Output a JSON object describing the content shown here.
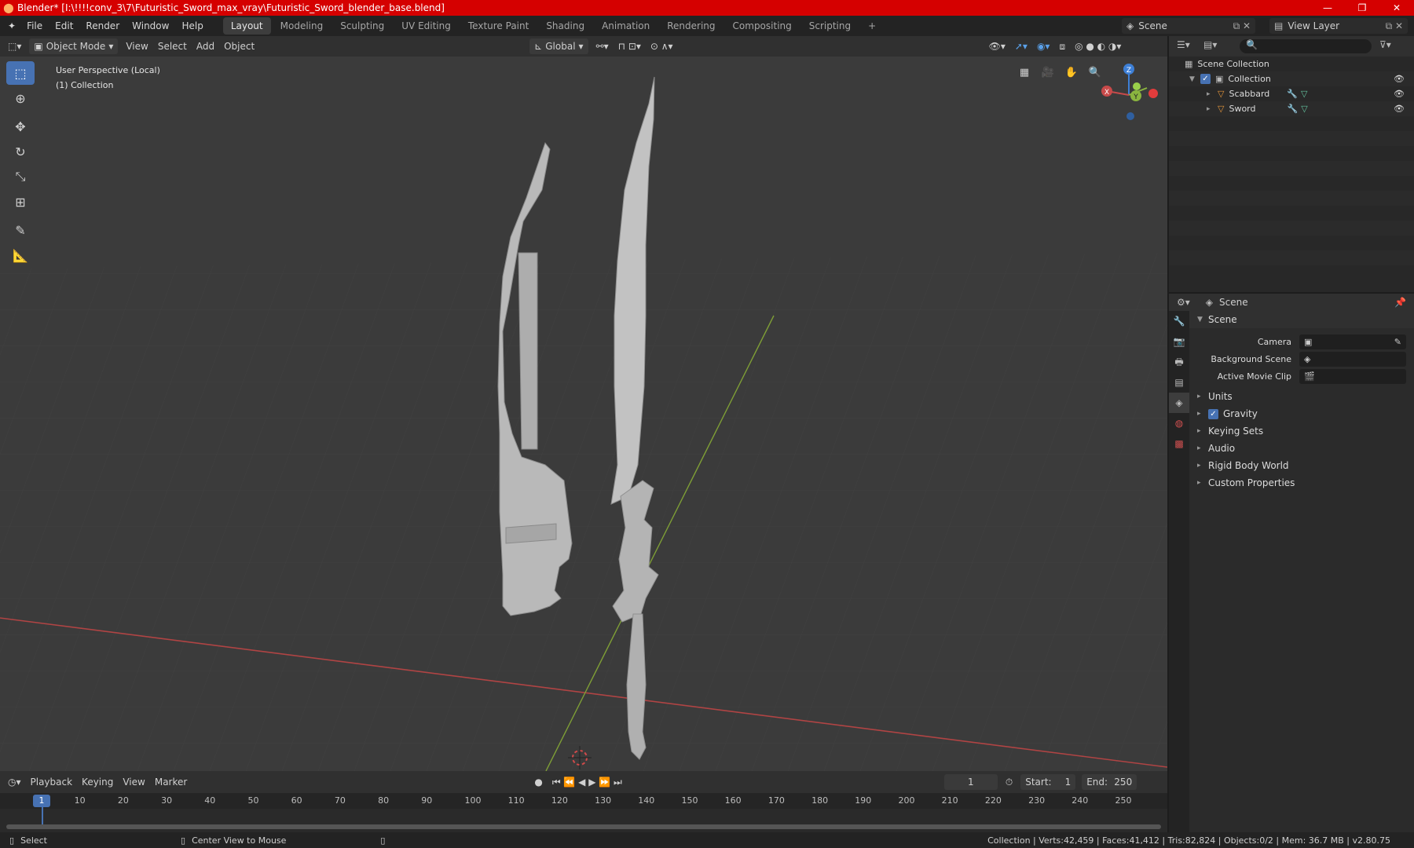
{
  "window": {
    "title": "Blender* [I:\\!!!!conv_3\\7\\Futuristic_Sword_max_vray\\Futuristic_Sword_blender_base.blend]",
    "controls": [
      "—",
      "❐",
      "✕"
    ]
  },
  "menu": [
    "File",
    "Edit",
    "Render",
    "Window",
    "Help"
  ],
  "workspaces": [
    "Layout",
    "Modeling",
    "Sculpting",
    "UV Editing",
    "Texture Paint",
    "Shading",
    "Animation",
    "Rendering",
    "Compositing",
    "Scripting"
  ],
  "active_workspace": "Layout",
  "add_workspace": "+",
  "scene_name": "Scene",
  "view_layer": "View Layer",
  "viewport_header": {
    "mode": "Object Mode",
    "menus": [
      "View",
      "Select",
      "Add",
      "Object"
    ],
    "transform_orientation": "Global"
  },
  "viewport": {
    "info_line1": "User Perspective (Local)",
    "info_line2": "(1) Collection",
    "gizmo": {
      "z": "Z",
      "y": "Y",
      "x": "X"
    }
  },
  "outliner": {
    "rows": [
      {
        "label": "Scene Collection",
        "indent": 0
      },
      {
        "label": "Collection",
        "indent": 1
      },
      {
        "label": "Scabbard",
        "indent": 2
      },
      {
        "label": "Sword",
        "indent": 2
      }
    ]
  },
  "properties": {
    "context": "Scene",
    "panel_title": "Scene",
    "fields": [
      {
        "label": "Camera",
        "value": ""
      },
      {
        "label": "Background Scene",
        "value": ""
      },
      {
        "label": "Active Movie Clip",
        "value": ""
      }
    ],
    "sections": [
      "Units",
      "Gravity",
      "Keying Sets",
      "Audio",
      "Rigid Body World",
      "Custom Properties"
    ]
  },
  "timeline": {
    "menus": [
      "Playback",
      "Keying",
      "View",
      "Marker"
    ],
    "current_frame": "1",
    "start_label": "Start:",
    "start": "1",
    "end_label": "End:",
    "end": "250",
    "ticks": [
      "1",
      "10",
      "20",
      "30",
      "40",
      "50",
      "60",
      "70",
      "80",
      "90",
      "100",
      "110",
      "120",
      "130",
      "140",
      "150",
      "160",
      "170",
      "180",
      "190",
      "200",
      "210",
      "220",
      "230",
      "240",
      "250"
    ]
  },
  "statusbar": {
    "left1": "Select",
    "left2": "Center View to Mouse",
    "right": "Collection | Verts:42,459 | Faces:41,412 | Tris:82,824 | Objects:0/2 | Mem: 36.7 MB | v2.80.75"
  },
  "colors": {
    "accent": "#4772b3",
    "titlebar": "#d50000",
    "x_axis": "#c84a4a",
    "y_axis": "#8bb53f",
    "z_axis": "#3d7fd6"
  }
}
